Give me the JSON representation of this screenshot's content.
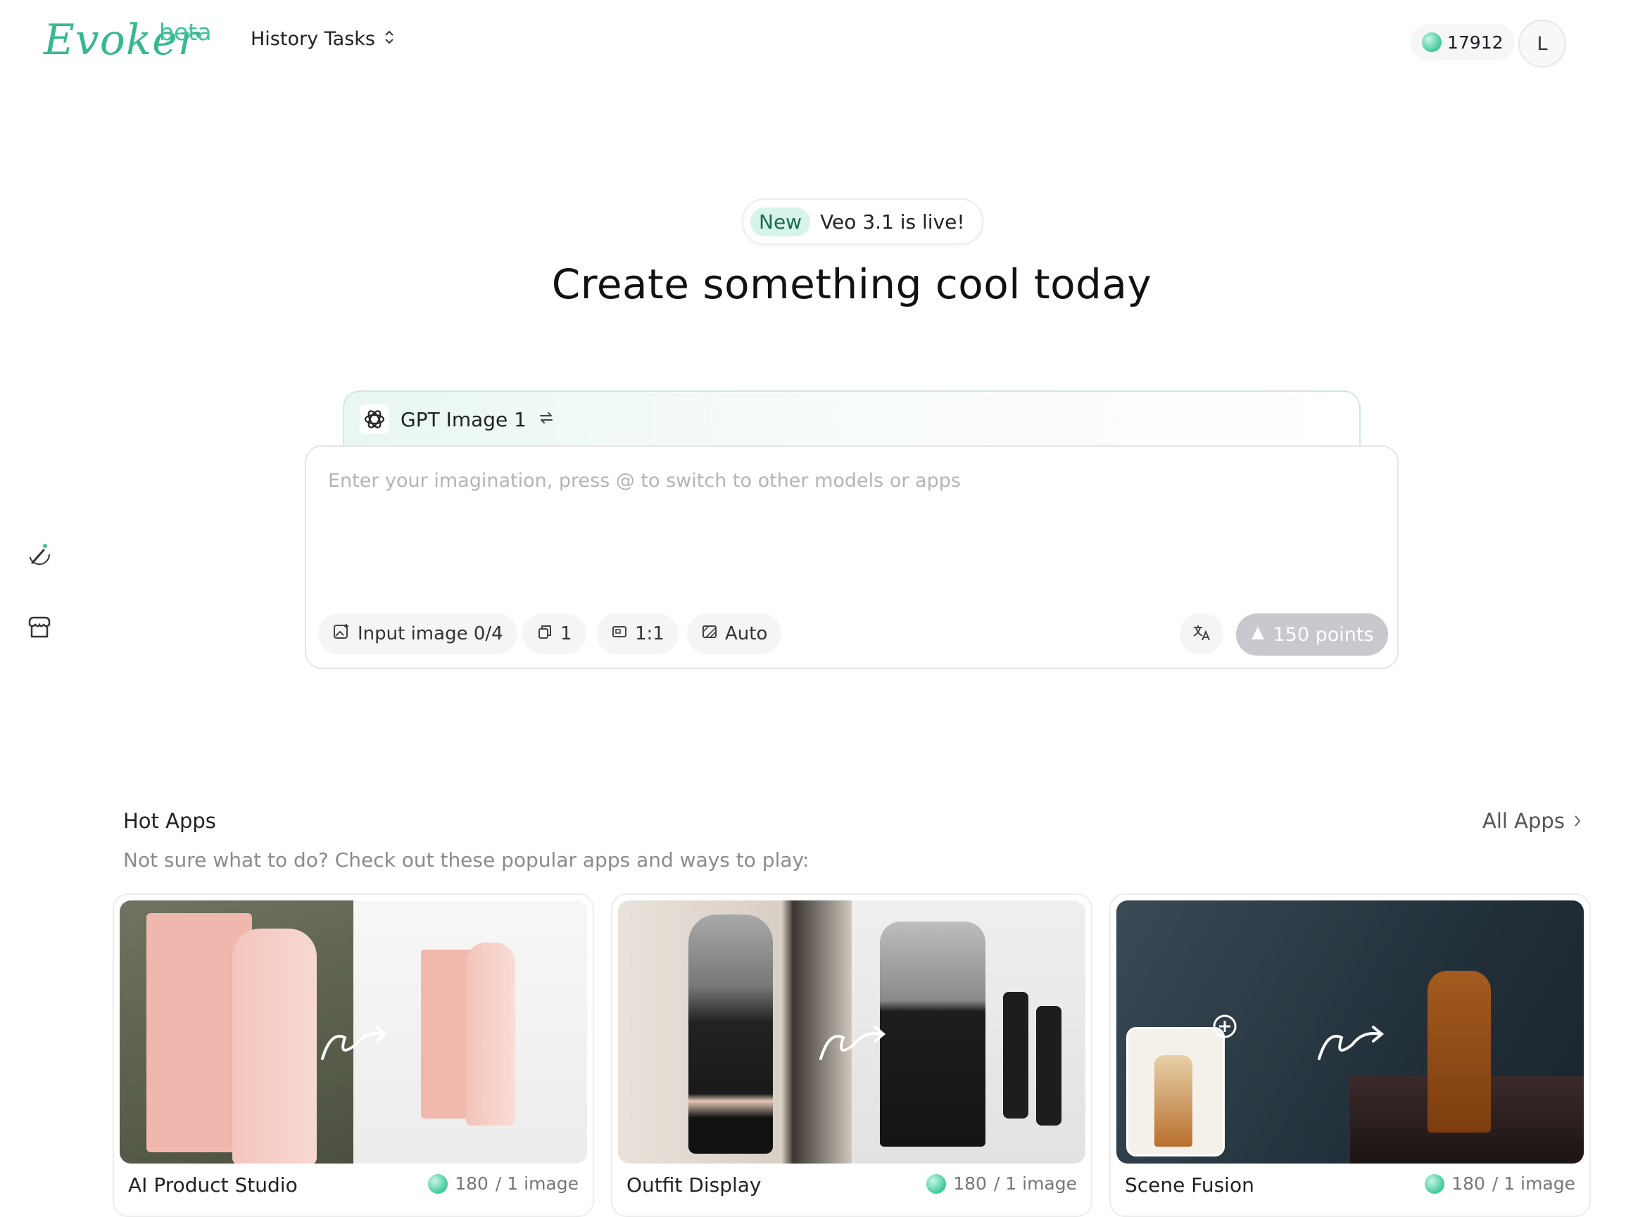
{
  "header": {
    "logo": "Evoker",
    "beta": "beta",
    "history_label": "History Tasks",
    "points": "17912",
    "avatar_initial": "L"
  },
  "announcement": {
    "badge": "New",
    "text": "Veo 3.1 is live!"
  },
  "headline": "Create something cool today",
  "composer": {
    "model_name": "GPT Image 1",
    "placeholder": "Enter your imagination, press @ to switch to other models or apps",
    "input_image": "Input image 0/4",
    "count": "1",
    "ratio": "1:1",
    "quality": "Auto",
    "submit": "150 points"
  },
  "hot_apps": {
    "title": "Hot Apps",
    "subtitle": "Not sure what to do? Check out these popular apps and ways to play:",
    "all_apps": "All Apps",
    "cards": [
      {
        "title": "AI Product Studio",
        "cost": "180",
        "per": "/ 1 image"
      },
      {
        "title": "Outfit Display",
        "cost": "180",
        "per": "/ 1 image"
      },
      {
        "title": "Scene Fusion",
        "cost": "180",
        "per": "/ 1 image"
      }
    ]
  },
  "icons": [
    "chevron-updown-icon",
    "coin-icon",
    "magic-wand-icon",
    "store-icon",
    "openai-icon",
    "swap-icon",
    "image-icon",
    "copy-icon",
    "ratio-icon",
    "quality-icon",
    "translate-icon",
    "arrow-up-icon",
    "chevron-right-icon"
  ],
  "colors": {
    "accent": "#3cc39a",
    "submit_disabled": "#c7c9ce"
  }
}
